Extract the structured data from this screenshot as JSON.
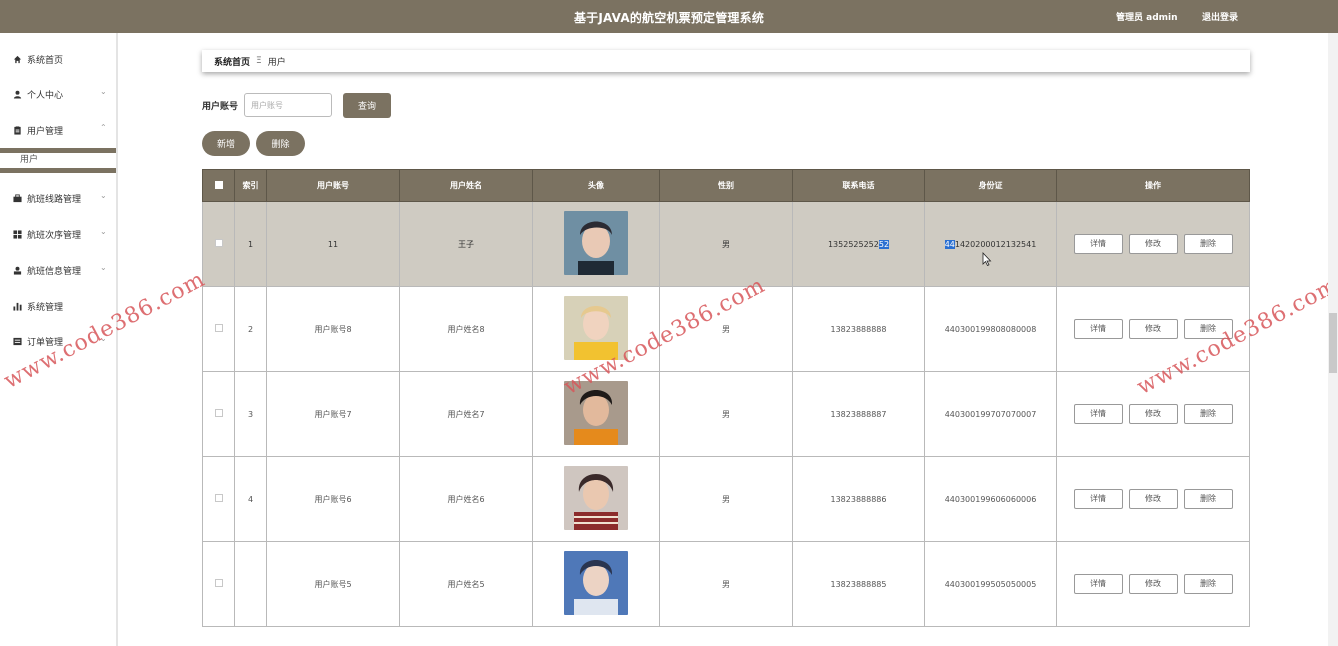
{
  "app": {
    "title": "基于JAVA的航空机票预定管理系统",
    "admin_label": "管理员 admin",
    "logout_label": "退出登录"
  },
  "sidebar": {
    "items": [
      {
        "label": "系统首页",
        "icon": "home-icon"
      },
      {
        "label": "个人中心",
        "icon": "person-icon"
      },
      {
        "label": "用户管理",
        "icon": "user-manage-icon"
      },
      {
        "label": "航班线路管理",
        "icon": "route-icon"
      },
      {
        "label": "航班次序管理",
        "icon": "grid-icon"
      },
      {
        "label": "航班信息管理",
        "icon": "info-icon"
      },
      {
        "label": "系统管理",
        "icon": "bar-chart-icon"
      },
      {
        "label": "订单管理",
        "icon": "order-icon"
      }
    ],
    "active_sub": "用户"
  },
  "breadcrumb": {
    "home": "系统首页",
    "separator": "Ξ",
    "current": "用户"
  },
  "search": {
    "label": "用户账号",
    "placeholder": "用户账号",
    "query_button": "查询"
  },
  "actions": {
    "add": "新增",
    "delete": "删除"
  },
  "table": {
    "headers": [
      "索引",
      "用户账号",
      "用户姓名",
      "头像",
      "性别",
      "联系电话",
      "身份证",
      "操作"
    ],
    "rows": [
      {
        "index": "1",
        "account": "11",
        "name": "王子",
        "gender": "男",
        "phone_a": "1352525252",
        "phone_b": "52",
        "idcard_a": "44",
        "idcard_b": "1420200012132541",
        "selected": true
      },
      {
        "index": "2",
        "account": "用户账号8",
        "name": "用户姓名8",
        "gender": "男",
        "phone": "13823888888",
        "idcard": "440300199808080008"
      },
      {
        "index": "3",
        "account": "用户账号7",
        "name": "用户姓名7",
        "gender": "男",
        "phone": "13823888887",
        "idcard": "440300199707070007"
      },
      {
        "index": "4",
        "account": "用户账号6",
        "name": "用户姓名6",
        "gender": "男",
        "phone": "13823888886",
        "idcard": "440300199606060006"
      },
      {
        "index": "",
        "account": "用户账号5",
        "name": "用户姓名5",
        "gender": "男",
        "phone": "13823888885",
        "idcard": "440300199505050005"
      }
    ],
    "row_buttons": {
      "detail": "详情",
      "edit": "修改",
      "delete": "删除"
    }
  },
  "watermark": "www.code386.com",
  "colors": {
    "brand": "#7b7261",
    "selected_row": "#cfcbc2",
    "watermark": "#d8565a"
  }
}
